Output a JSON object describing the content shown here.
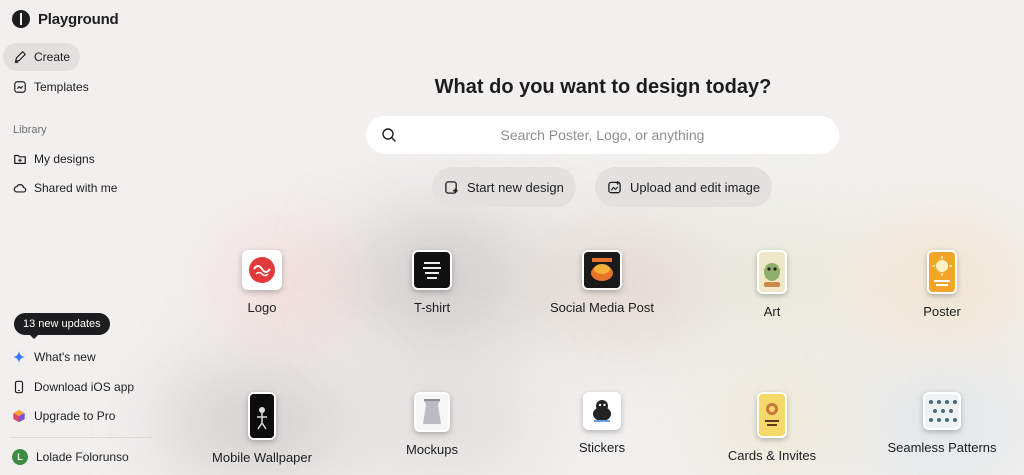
{
  "app": {
    "name": "Playground"
  },
  "sidebar": {
    "nav": [
      {
        "label": "Create",
        "icon": "create-icon"
      },
      {
        "label": "Templates",
        "icon": "templates-icon"
      }
    ],
    "library_label": "Library",
    "library": [
      {
        "label": "My designs",
        "icon": "folder-icon"
      },
      {
        "label": "Shared with me",
        "icon": "cloud-icon"
      }
    ],
    "updates_badge": "13 new updates",
    "bottom": [
      {
        "label": "What's new",
        "icon": "sparkle-icon"
      },
      {
        "label": "Download iOS app",
        "icon": "phone-icon"
      },
      {
        "label": "Upgrade to Pro",
        "icon": "pro-cube-icon"
      }
    ],
    "user": {
      "initial": "L",
      "name": "Lolade Folorunso"
    }
  },
  "main": {
    "headline": "What do you want to design today?",
    "search_placeholder": "Search Poster, Logo, or anything",
    "actions": [
      {
        "label": "Start new design",
        "icon": "new-design-icon"
      },
      {
        "label": "Upload and edit image",
        "icon": "upload-image-icon"
      }
    ],
    "categories": [
      {
        "label": "Logo"
      },
      {
        "label": "T-shirt"
      },
      {
        "label": "Social Media Post"
      },
      {
        "label": "Art"
      },
      {
        "label": "Poster"
      },
      {
        "label": "Mobile Wallpaper"
      },
      {
        "label": "Mockups"
      },
      {
        "label": "Stickers"
      },
      {
        "label": "Cards & Invites"
      },
      {
        "label": "Seamless Patterns"
      }
    ]
  },
  "colors": {
    "background": "#f1f0ef",
    "active_nav": "#e2e0de",
    "badge": "#1d1d1f",
    "sparkle": "#3478f6",
    "avatar": "#3d8c40"
  }
}
